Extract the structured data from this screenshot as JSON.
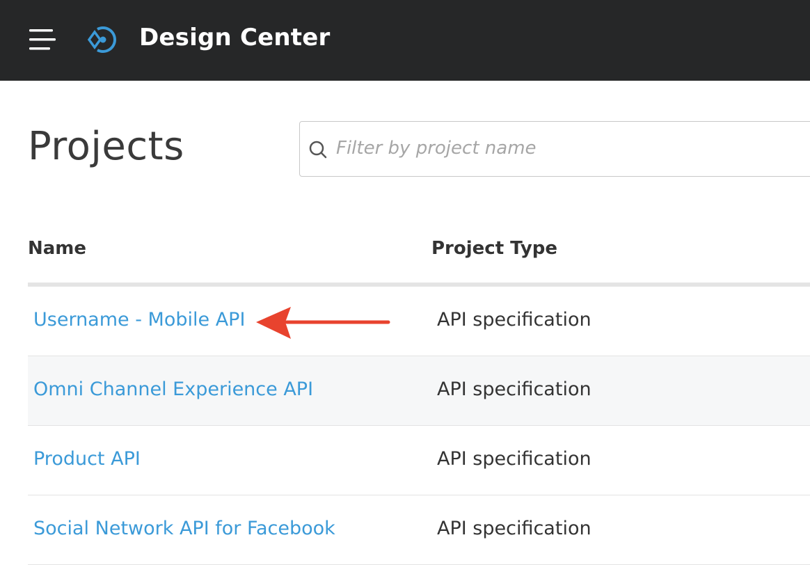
{
  "header": {
    "title": "Design Center",
    "menu_icon": "hamburger-menu-icon",
    "logo_icon": "design-center-logo-icon",
    "background": "#262728"
  },
  "main": {
    "title": "Projects",
    "search": {
      "placeholder": "Filter by project name",
      "value": "",
      "icon": "search-icon"
    }
  },
  "table": {
    "columns": [
      "Name",
      "Project Type"
    ],
    "rows": [
      {
        "name": "Username - Mobile API",
        "type": "API specification"
      },
      {
        "name": "Omni Channel Experience API",
        "type": "API specification"
      },
      {
        "name": "Product API",
        "type": "API specification"
      },
      {
        "name": "Social Network API for Facebook",
        "type": "API specification"
      }
    ]
  },
  "colors": {
    "link": "#3b9ad8",
    "annotation_arrow": "#e8432e"
  }
}
